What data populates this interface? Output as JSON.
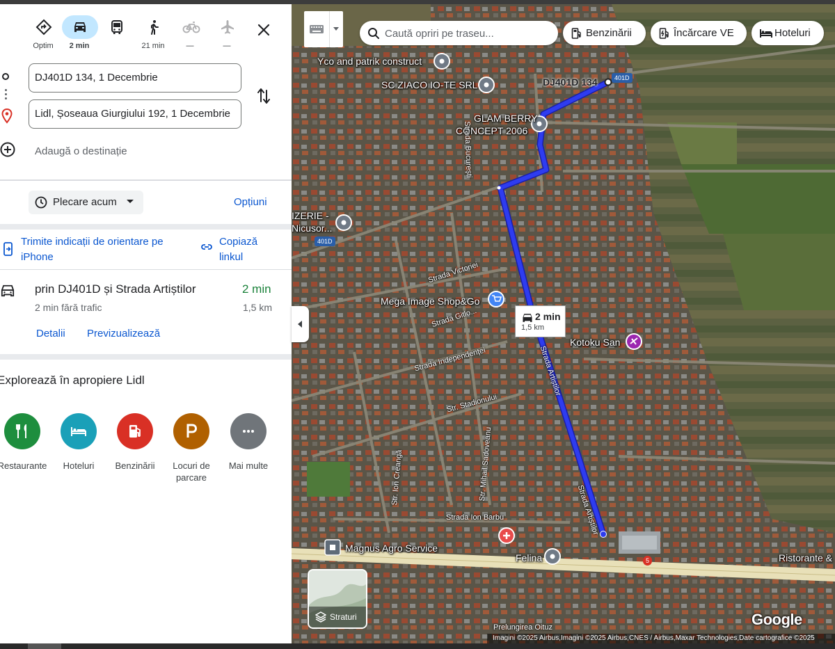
{
  "travel_modes": [
    {
      "name": "Optim",
      "label": "Optim",
      "active": false
    },
    {
      "name": "car",
      "label": "2 min",
      "active": true
    },
    {
      "name": "transit",
      "label": "",
      "active": false
    },
    {
      "name": "walk",
      "label": "21 min",
      "active": false
    },
    {
      "name": "bike",
      "label": "—",
      "active": false
    },
    {
      "name": "flight",
      "label": "—",
      "active": false
    }
  ],
  "directions": {
    "origin": "DJ401D 134, 1 Decembrie",
    "destination": "Lidl, Șoseaua Giurgiului 192, 1 Decembrie",
    "add_destination": "Adaugă o destinație",
    "depart_label": "Plecare acum",
    "options_label": "Opțiuni",
    "send_to_phone": "Trimite indicații de orientare pe iPhone",
    "copy_link": "Copiază linkul"
  },
  "route": {
    "title": "prin DJ401D și Strada Artiștilor",
    "time": "2 min",
    "subtitle": "2 min fără trafic",
    "distance": "1,5 km",
    "details_label": "Detalii",
    "preview_label": "Previzualizează"
  },
  "explore": {
    "title": "Explorează în apropiere Lidl",
    "categories": [
      {
        "label": "Restaurante",
        "color": "#1e8e3e",
        "icon": "fork-knife-icon"
      },
      {
        "label": "Hoteluri",
        "color": "#12b5cb",
        "icon": "bed-icon"
      },
      {
        "label": "Benzinării",
        "color": "#d93025",
        "icon": "gas-pump-icon"
      },
      {
        "label": "Locuri de parcare",
        "color": "#b06000",
        "icon": "parking-icon"
      },
      {
        "label": "Mai multe",
        "color": "#70757a",
        "icon": "more-icon"
      }
    ]
  },
  "map": {
    "search_placeholder": "Caută opriri pe traseu...",
    "chips": [
      "Benzinării",
      "Încărcare VE",
      "Hoteluri"
    ],
    "route_tooltip": {
      "time": "2 min",
      "distance": "1,5 km"
    },
    "layers_label": "Straturi",
    "brand": "Google",
    "attribution": "Imagini ©2025 Airbus,Imagini ©2025 Airbus,CNES / Airbus,Maxar Technologies,Date cartografice ©2025",
    "route_color": "#2e3cf0",
    "places": [
      {
        "name": "Yco and patrik construct"
      },
      {
        "name": "SC ZIACO IO-TE SRL"
      },
      {
        "name": "GLAM BERRY"
      },
      {
        "name": "CONCEPT 2006"
      },
      {
        "name": "DJ401D 134"
      },
      {
        "name": "IZERIE -"
      },
      {
        "name": "Nicusor..."
      },
      {
        "name": "Mega Image Shop&Go"
      },
      {
        "name": "Kotoku San"
      },
      {
        "name": "Magnus Agro Service"
      },
      {
        "name": "Felina"
      },
      {
        "name": "Ristorante &"
      }
    ],
    "streets": [
      "Strada Bucureşti",
      "Strada Victoriei",
      "Strada Gitlo...",
      "Strada Independenței",
      "Str. Stadionului",
      "Str. Ion Creangă",
      "Str. Mihail Sadoveanu",
      "Strada Ion Barbu",
      "Strada Artiștilor",
      "Prelungirea Oituz"
    ],
    "road_badges": [
      "401D",
      "401D",
      "5"
    ]
  }
}
